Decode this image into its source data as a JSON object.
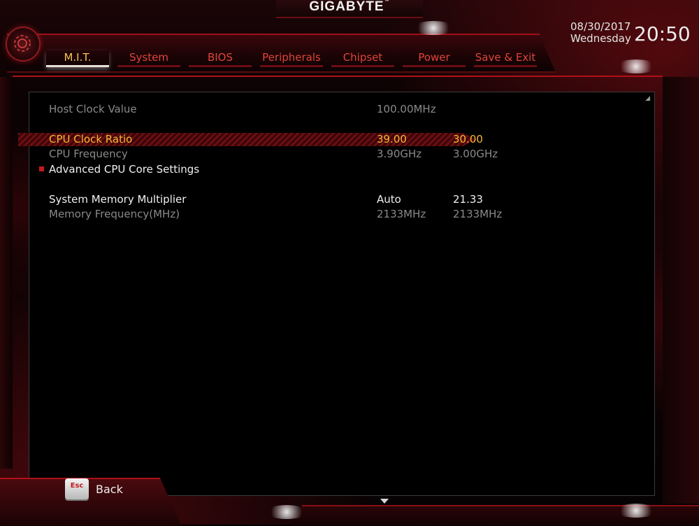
{
  "header": {
    "brand": "GIGABYTE",
    "brand_mark": "™",
    "date": "08/30/2017",
    "weekday": "Wednesday",
    "time": "20:50"
  },
  "tabs": [
    {
      "label": "M.I.T.",
      "active": true
    },
    {
      "label": "System",
      "active": false
    },
    {
      "label": "BIOS",
      "active": false
    },
    {
      "label": "Peripherals",
      "active": false
    },
    {
      "label": "Chipset",
      "active": false
    },
    {
      "label": "Power",
      "active": false
    },
    {
      "label": "Save & Exit",
      "active": false
    }
  ],
  "settings": {
    "host_clock": {
      "label": "Host Clock Value",
      "value": "100.00MHz"
    },
    "cpu_ratio": {
      "label": "CPU Clock Ratio",
      "value": "39.00",
      "current": "30.00"
    },
    "cpu_freq": {
      "label": "CPU Frequency",
      "value": "3.90GHz",
      "current": "3.00GHz"
    },
    "adv_cpu": {
      "label": "Advanced CPU Core Settings"
    },
    "mem_mult": {
      "label": "System Memory Multiplier",
      "value": "Auto",
      "current": "21.33"
    },
    "mem_freq": {
      "label": "Memory Frequency(MHz)",
      "value": "2133MHz",
      "current": "2133MHz"
    }
  },
  "footer": {
    "esc_key": "Esc",
    "back_label": "Back"
  },
  "colors": {
    "accent_red": "#c8181e",
    "selected_text": "#f7b733",
    "tab_text": "#e0453a"
  }
}
